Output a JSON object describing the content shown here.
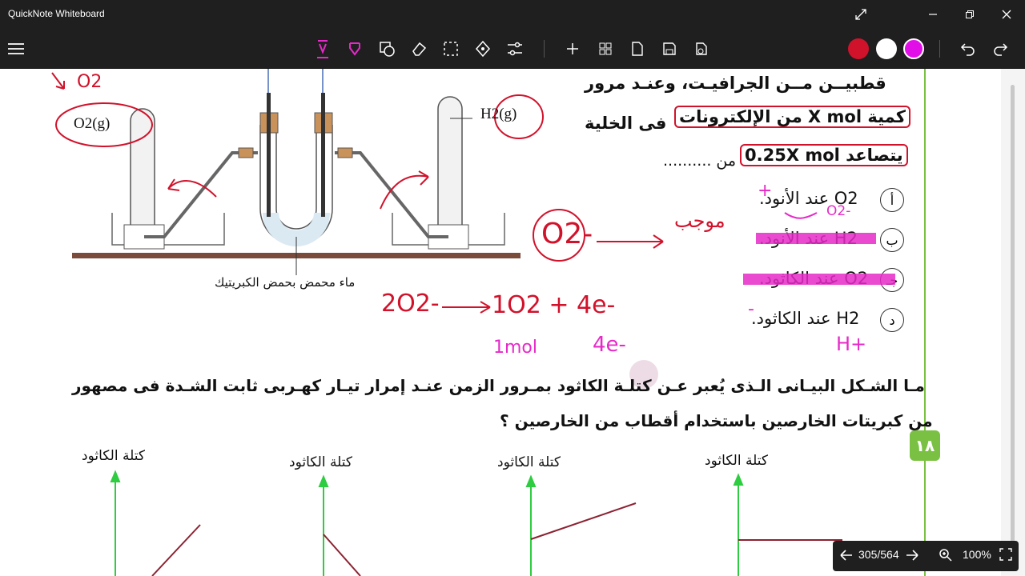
{
  "window": {
    "title": "QuickNote Whiteboard"
  },
  "toolbar": {
    "colors": [
      "#d1122b",
      "#ffffff",
      "#e20ee8"
    ],
    "tools": [
      "pen-icon",
      "highlighter-icon",
      "shapes-icon",
      "eraser-icon",
      "select-icon",
      "move-icon",
      "settings-icon",
      "add-icon",
      "pages-icon",
      "page-icon",
      "save-icon",
      "export-icon",
      "undo-icon",
      "redo-icon"
    ]
  },
  "diagram": {
    "o2_label": "O2(g)",
    "h2_label": "H2(g)",
    "water_label": "ماء محمض بحمض الكبريتيك",
    "top_o2": "O2"
  },
  "question17": {
    "line1": "قطبيــن مــن الجرافيـت، وعنـد مرور",
    "line2_box": "كمية X mol من الإلكترونات",
    "line2_tail": "فى الخلية",
    "line3_box": "يتصاعد 0.25X mol",
    "line3_tail": "من ..........",
    "options": [
      {
        "letter": "أ",
        "text": "O2 عند الأنود."
      },
      {
        "letter": "ب",
        "text": "H2 عند الأنود."
      },
      {
        "letter": "جـ",
        "text": "O2 عند الكاثود."
      },
      {
        "letter": "د",
        "text": "H2 عند الكاثود."
      }
    ]
  },
  "annotations": {
    "o2minus": "O2-",
    "mujab": "موجب",
    "equation_left": "2O2-",
    "equation_right": "1O2 + 4e-",
    "one_mol": "1mol",
    "four_e": "4e-",
    "h_plus": "H+",
    "plus_sign": "+",
    "minus_sign": "-",
    "o2_small": "O2-"
  },
  "question18": {
    "number": "١٨",
    "line1": "مـا الشـكل البيـانى الـذى يُعبر عـن كتلـة الكاثود بمـرور الزمن عنـد إمرار تيـار كهـربى ثابت الشـدة فى مصهور",
    "line2": "من كبريتات الخارصين باستخدام أقطاب من الخارصين ؟",
    "graph_label": "كتلة الكاثود"
  },
  "pagenav": {
    "page": "305/564",
    "zoom": "100%"
  }
}
